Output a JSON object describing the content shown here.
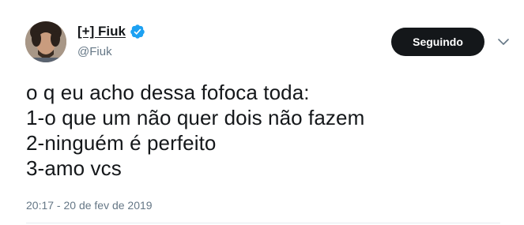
{
  "tweet": {
    "author": {
      "display_name": "[+] Fiuk",
      "handle": "@Fiuk",
      "verified": true,
      "avatar_icon": "profile-photo"
    },
    "follow_button_label": "Seguindo",
    "menu_icon": "chevron-down-icon",
    "text": "o q eu acho dessa fofoca toda:\n1-o que um não quer dois não fazem\n2-ninguém é perfeito\n3-amo vcs",
    "timestamp": "20:17 - 20 de fev de 2019"
  },
  "colors": {
    "verified_badge": "#1da1f2",
    "button_bg": "#14171a",
    "secondary_text": "#657786",
    "divider": "#e6ecf0"
  }
}
